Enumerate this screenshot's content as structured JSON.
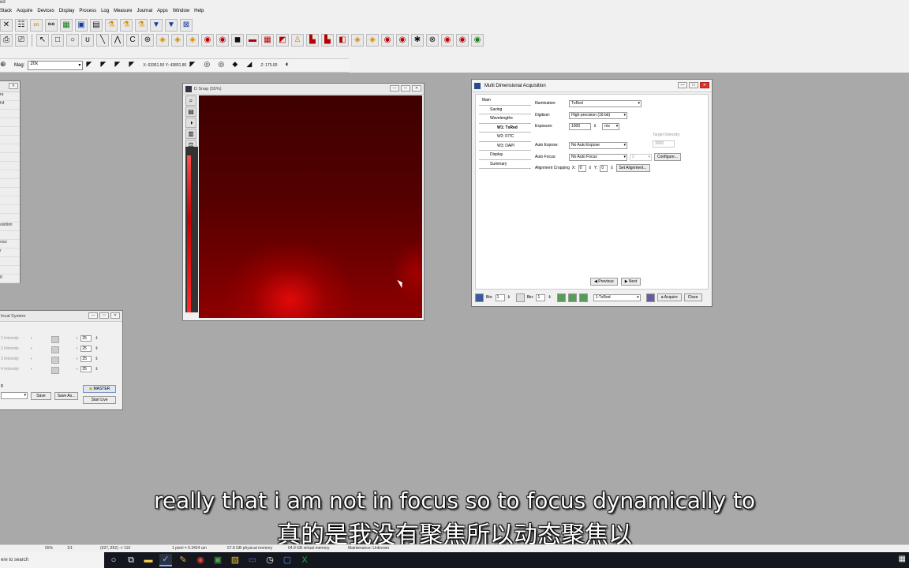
{
  "app": {
    "title_fragment": "ed"
  },
  "menu": [
    "Stack",
    "Acquire",
    "Devices",
    "Display",
    "Process",
    "Log",
    "Measure",
    "Journal",
    "Apps",
    "Window",
    "Help"
  ],
  "toolbar_row3": {
    "mag_label": "Mag:",
    "mag_value": "20x",
    "xy_readout": "X: 63351.50 Y: 43801.80",
    "z_readout": "Z: 175.00"
  },
  "left_panel_items": [
    "ra",
    "h4",
    "",
    "",
    "",
    "",
    "",
    "",
    "",
    "",
    "",
    "",
    "",
    "",
    "",
    "uisition",
    "",
    "vice",
    "r",
    "",
    "",
    "g"
  ],
  "snap_window": {
    "title": "D Snap (55%)"
  },
  "mda": {
    "title": "Multi Dimensional Acquisition",
    "nav": [
      {
        "label": "Main",
        "level": 0
      },
      {
        "label": "Saving",
        "level": 1
      },
      {
        "label": "Wavelengths",
        "level": 1
      },
      {
        "label": "W1: TxRed",
        "level": 2,
        "selected": true
      },
      {
        "label": "W2: FITC",
        "level": 2
      },
      {
        "label": "W3: DAPI",
        "level": 2
      },
      {
        "label": "Display",
        "level": 1
      },
      {
        "label": "Summary",
        "level": 1
      }
    ],
    "illumination_label": "Illumination:",
    "illumination_value": "TxRed",
    "digitizer_label": "Digitizer:",
    "digitizer_value": "High-precision (16-bit)",
    "exposure_label": "Exposure:",
    "exposure_value": "1000",
    "exposure_unit": "ms",
    "target_intensity_label": "Target Intensity:",
    "target_intensity_value": "3000",
    "auto_expose_label": "Auto Expose:",
    "auto_expose_value": "No Auto Expose",
    "auto_focus_label": "Auto Focus:",
    "auto_focus_value": "No Auto Focus",
    "auto_focus_num": "2",
    "configure_label": "Configure...",
    "alignment_label": "Alignment Cropping",
    "x_label": "X:",
    "x_value": "0",
    "y_label": "Y:",
    "y_value": "0",
    "set_alignment_label": "Set Alignment...",
    "previous_label": "Previous",
    "next_label": "Next",
    "bin_label": "Bin:",
    "bin1_value": "1",
    "bin2_value": "1",
    "wavelength_select": "1:TxRed",
    "acquire_label": "Acquire",
    "close_label": "Close"
  },
  "confocal": {
    "title": "focal System",
    "rows": [
      {
        "label": "1 Intensity",
        "value": "25"
      },
      {
        "label": "2 Intensity",
        "value": "25"
      },
      {
        "label": "3 Intensity",
        "value": "25"
      },
      {
        "label": "4 Intensity",
        "value": "25"
      }
    ],
    "g_label": "g",
    "save_label": "Save",
    "save_as_label": "Save As...",
    "master_label": "MASTER",
    "start_live_label": "Start Live"
  },
  "subtitles": {
    "en": "really that i am not in focus so to focus dynamically to",
    "zh": "真的是我没有聚焦所以动态聚焦以"
  },
  "status": {
    "zoom": "55%",
    "frame": "1/1",
    "pixel_coords": "(927, 852) -> 110",
    "pixel_size": "1 pixel = 0.3424 um",
    "physical_memory": "57.8 GB physical memory",
    "virtual_memory": "64.9 GB virtual memory",
    "maintenance": "Maintenance: Unknown"
  },
  "taskbar": {
    "search_placeholder": "ere to search"
  }
}
